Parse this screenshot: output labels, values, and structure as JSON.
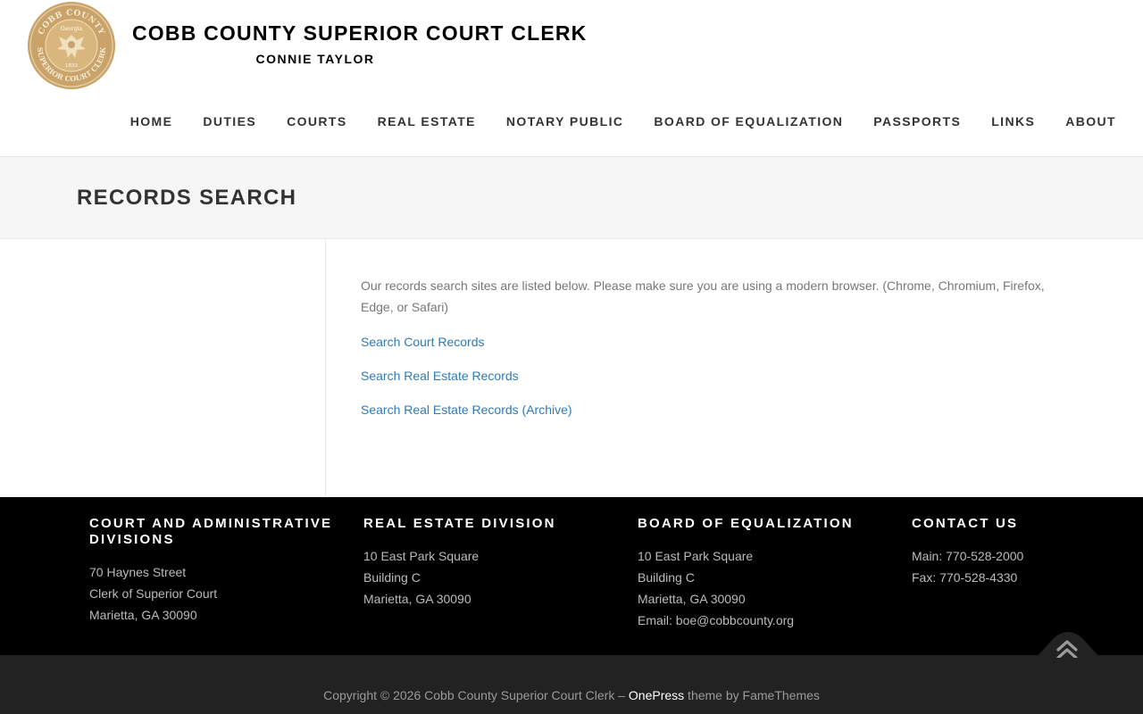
{
  "header": {
    "seal_text_top": "COBB COUNTY",
    "seal_text_bottom": "SUPERIOR COURT CLERK",
    "seal_center": "Georgia",
    "seal_year": "1833",
    "title": "COBB COUNTY SUPERIOR COURT CLERK",
    "subtitle": "CONNIE TAYLOR"
  },
  "nav": {
    "items": [
      {
        "label": "HOME"
      },
      {
        "label": "DUTIES"
      },
      {
        "label": "COURTS"
      },
      {
        "label": "REAL ESTATE"
      },
      {
        "label": "NOTARY PUBLIC"
      },
      {
        "label": "BOARD OF EQUALIZATION"
      },
      {
        "label": "PASSPORTS"
      },
      {
        "label": "LINKS"
      },
      {
        "label": "ABOUT"
      }
    ]
  },
  "page": {
    "title": "RECORDS SEARCH",
    "intro": "Our records search sites are listed below. Please make sure you are using a modern browser. (Chrome, Chromium, Firefox, Edge, or Safari)",
    "links": [
      {
        "label": "Search Court Records"
      },
      {
        "label": "Search Real Estate Records"
      },
      {
        "label": "Search Real Estate Records (Archive)"
      }
    ]
  },
  "footer": {
    "columns": [
      {
        "heading": "COURT AND ADMINISTRATIVE DIVISIONS",
        "lines": [
          "70 Haynes Street",
          "Clerk of Superior Court",
          "Marietta, GA 30090"
        ]
      },
      {
        "heading": "REAL ESTATE DIVISION",
        "lines": [
          "10 East Park Square",
          "Building C",
          "Marietta, GA 30090"
        ]
      },
      {
        "heading": "BOARD OF EQUALIZATION",
        "lines": [
          "10 East Park Square",
          "Building C",
          "Marietta, GA 30090",
          "Email: boe@cobbcounty.org"
        ]
      },
      {
        "heading": "CONTACT US",
        "lines": [
          "Main: 770-528-2000",
          "Fax: 770-528-4330"
        ]
      }
    ],
    "copyright_prefix": "Copyright © 2026 Cobb County Superior Court Clerk – ",
    "copyright_brand": "OnePress",
    "copyright_suffix": " theme by FameThemes"
  },
  "colors": {
    "link": "#2f7bb5",
    "seal_gold": "#c9a36a",
    "footer_bg": "#000000",
    "bottom_bg": "#222222"
  },
  "icons": {
    "seal": "county-seal-icon",
    "back_to_top": "double-chevron-up-icon"
  }
}
